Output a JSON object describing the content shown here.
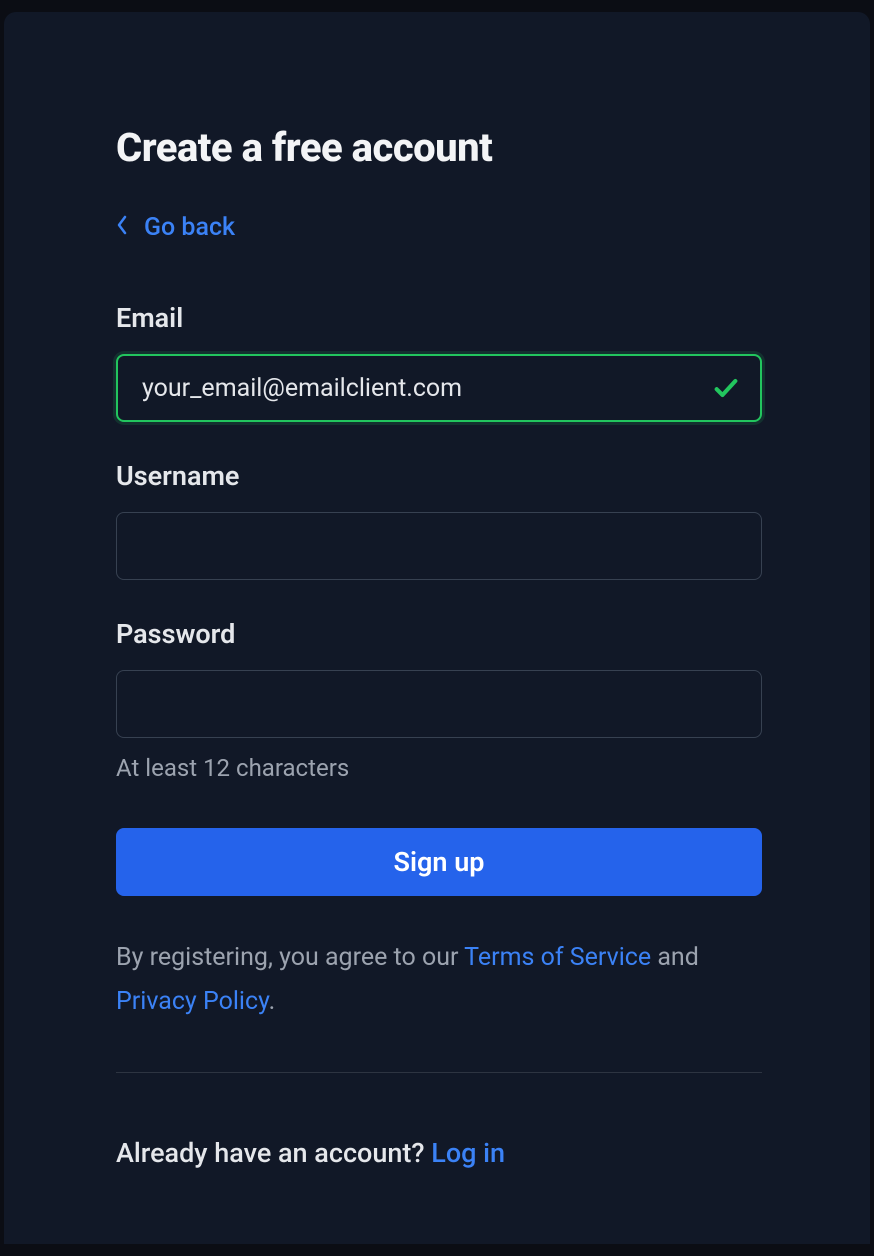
{
  "title": "Create a free account",
  "go_back": "Go back",
  "fields": {
    "email": {
      "label": "Email",
      "value": "your_email@emailclient.com",
      "valid": true
    },
    "username": {
      "label": "Username",
      "value": ""
    },
    "password": {
      "label": "Password",
      "value": "",
      "hint": "At least 12 characters"
    }
  },
  "signup_button": "Sign up",
  "legal": {
    "prefix": "By registering, you agree to our ",
    "terms": "Terms of Service",
    "middle": " and ",
    "privacy": "Privacy Policy",
    "suffix": "."
  },
  "login_prompt": {
    "text": "Already have an account? ",
    "link": "Log in"
  }
}
